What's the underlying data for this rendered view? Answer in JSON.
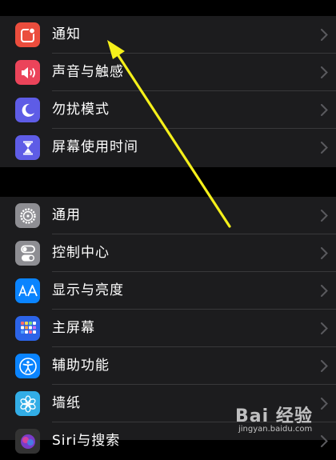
{
  "groups": [
    {
      "items": [
        {
          "label": "通知",
          "icon": "notifications-icon",
          "color": "#eb4d3d"
        },
        {
          "label": "声音与触感",
          "icon": "sound-icon",
          "color": "#eb445a"
        },
        {
          "label": "勿扰模式",
          "icon": "moon-icon",
          "color": "#5e5ce6"
        },
        {
          "label": "屏幕使用时间",
          "icon": "hourglass-icon",
          "color": "#5e5ce6"
        }
      ]
    },
    {
      "items": [
        {
          "label": "通用",
          "icon": "gear-icon",
          "color": "#8e8e93"
        },
        {
          "label": "控制中心",
          "icon": "toggles-icon",
          "color": "#8e8e93"
        },
        {
          "label": "显示与亮度",
          "icon": "text-size-icon",
          "color": "#0a84ff"
        },
        {
          "label": "主屏幕",
          "icon": "home-grid-icon",
          "color": "#0a84ff"
        },
        {
          "label": "辅助功能",
          "icon": "accessibility-icon",
          "color": "#0a84ff"
        },
        {
          "label": "墙纸",
          "icon": "flower-icon",
          "color": "#32ade6"
        },
        {
          "label": "Siri与搜索",
          "icon": "siri-icon",
          "color": "#333333"
        }
      ]
    }
  ],
  "annotation": {
    "color": "#f5f01a"
  },
  "watermark": {
    "main": "Bai 经验",
    "sub": "jingyan.baidu.com"
  }
}
